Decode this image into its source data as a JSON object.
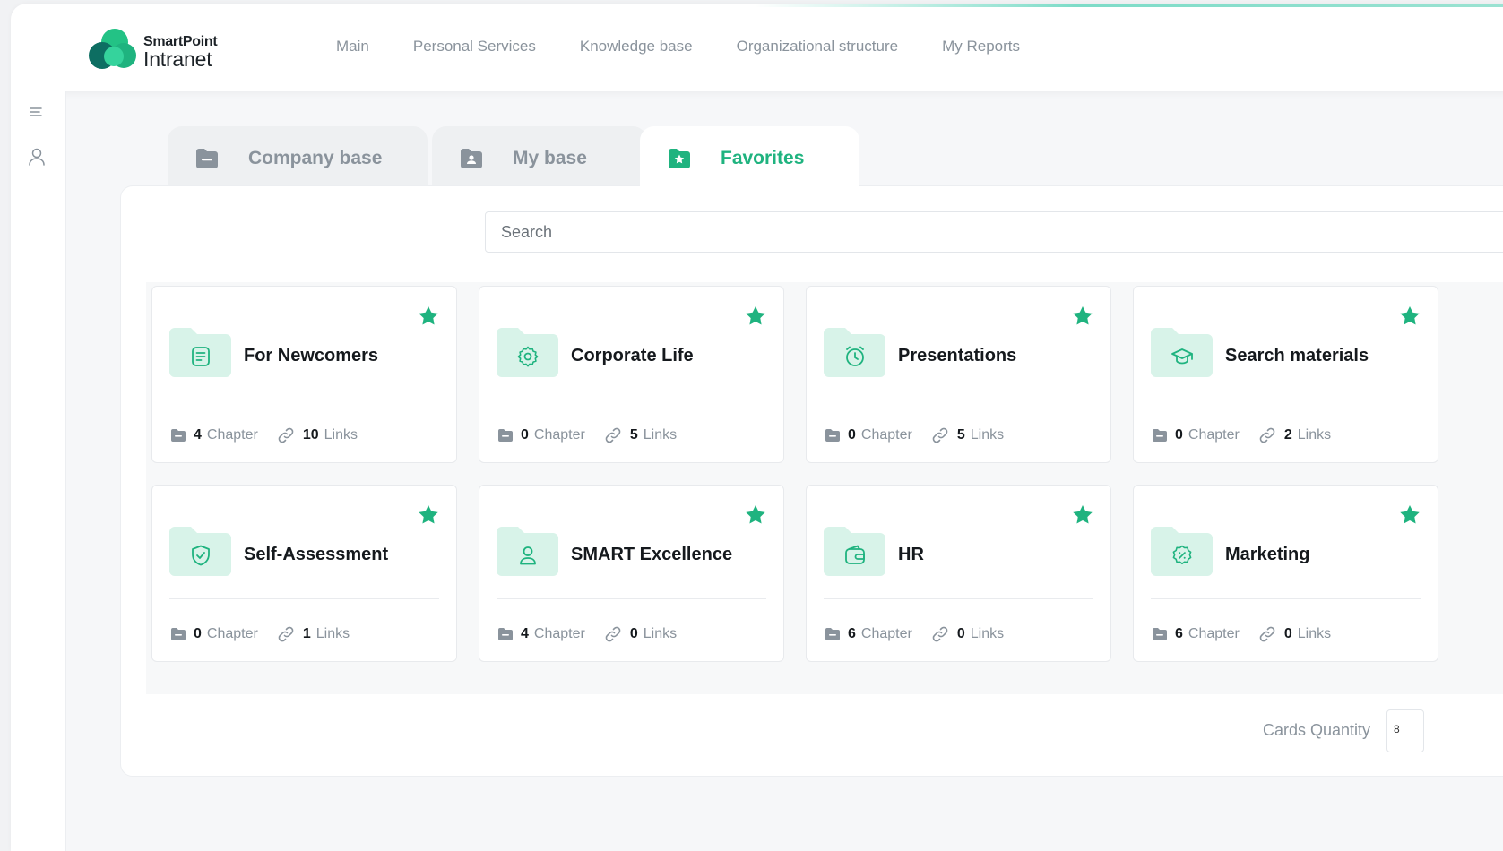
{
  "app": {
    "logo_line1": "SmartPoint",
    "logo_line2": "Intranet",
    "brand_color": "#1fb37f"
  },
  "nav": {
    "items": [
      {
        "label": "Main"
      },
      {
        "label": "Personal Services"
      },
      {
        "label": "Knowledge base"
      },
      {
        "label": "Organizational structure"
      },
      {
        "label": "My Reports"
      }
    ]
  },
  "sidebar": {
    "icons": [
      "menu-icon",
      "user-icon"
    ]
  },
  "tabs": [
    {
      "label": "Company base",
      "icon": "folder-icon",
      "active": false
    },
    {
      "label": "My base",
      "icon": "folder-user-icon",
      "active": false
    },
    {
      "label": "Favorites",
      "icon": "folder-star-icon",
      "active": true
    }
  ],
  "search": {
    "placeholder": "Search"
  },
  "cards": [
    {
      "title": "For Newcomers",
      "icon": "note-icon",
      "chapters": "4",
      "links": "10",
      "favorite": true
    },
    {
      "title": "Corporate Life",
      "icon": "gear-icon",
      "chapters": "0",
      "links": "5",
      "favorite": true
    },
    {
      "title": "Presentations",
      "icon": "alarm-clock-icon",
      "chapters": "0",
      "links": "5",
      "favorite": true
    },
    {
      "title": "Search materials",
      "icon": "graduation-cap-icon",
      "chapters": "0",
      "links": "2",
      "favorite": true
    },
    {
      "title": "Self-Assessment",
      "icon": "shield-check-icon",
      "chapters": "0",
      "links": "1",
      "favorite": true
    },
    {
      "title": "SMART Excellence",
      "icon": "user-icon",
      "chapters": "4",
      "links": "0",
      "favorite": true
    },
    {
      "title": "HR",
      "icon": "wallet-icon",
      "chapters": "6",
      "links": "0",
      "favorite": true
    },
    {
      "title": "Marketing",
      "icon": "discount-badge-icon",
      "chapters": "6",
      "links": "0",
      "favorite": true
    }
  ],
  "card_labels": {
    "chapter": "Chapter",
    "links": "Links"
  },
  "footer": {
    "cards_quantity_label": "Cards Quantity",
    "cards_quantity_value": "8"
  }
}
